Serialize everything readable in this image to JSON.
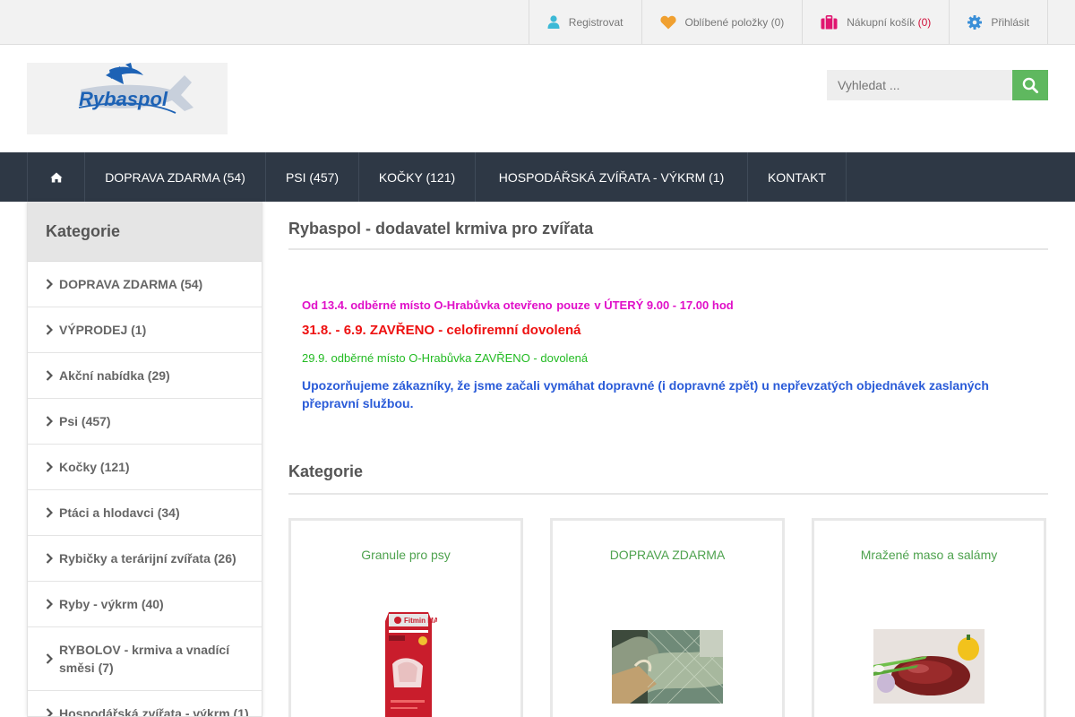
{
  "topbar": {
    "register": "Registrovat",
    "favorites_label": "Oblíbené položky",
    "favorites_count": "(0)",
    "cart_label": "Nákupní košík",
    "cart_count": "(0)",
    "login": "Přihlásit"
  },
  "logo": {
    "text": "Rybaspol"
  },
  "search": {
    "placeholder": "Vyhledat ..."
  },
  "nav": {
    "items": [
      "DOPRAVA ZDARMA (54)",
      "PSI (457)",
      "KOČKY (121)",
      "HOSPODÁŘSKÁ ZVÍŘATA - VÝKRM (1)",
      "KONTAKT"
    ]
  },
  "sidebar": {
    "title": "Kategorie",
    "items": [
      "DOPRAVA ZDARMA (54)",
      "VÝPRODEJ (1)",
      "Akční nabídka (29)",
      "Psi (457)",
      "Kočky (121)",
      "Ptáci a hlodavci (34)",
      "Rybičky a terárijní zvířata (26)",
      "Ryby - výkrm (40)",
      "RYBOLOV - krmiva a vnadící směsi (7)",
      "Hospodářská zvířata - výkrm (1)"
    ]
  },
  "main": {
    "title": "Rybaspol - dodavatel krmiva pro zvířata",
    "notice1_a": "Od 13.4. odběrné místo O-Hrabůvka otevřeno ",
    "notice1_b": "pouze",
    "notice1_c": " v ÚTERÝ 9.00 - 17.00 hod",
    "notice2": "31.8. - 6.9. ZAVŘENO - celofiremní dovolená",
    "notice3": "29.9. odběrné místo O-Hrabůvka ZAVŘENO - dovolená",
    "notice4": "Upozorňujeme zákazníky, že jsme začali vymáhat dopravné (i dopravné zpět) u nepřevzatých objednávek zaslaných přepravní službou.",
    "categories_title": "Kategorie",
    "cards": [
      {
        "title": "Granule pro psy",
        "image_text": "Fitmin MAINTENANCE"
      },
      {
        "title": "DOPRAVA ZDARMA"
      },
      {
        "title": "Mražené maso a salámy"
      }
    ]
  },
  "colors": {
    "nav_bg": "#2e3845",
    "accent_green": "#5fb85f",
    "card_title": "#4ea24e"
  }
}
